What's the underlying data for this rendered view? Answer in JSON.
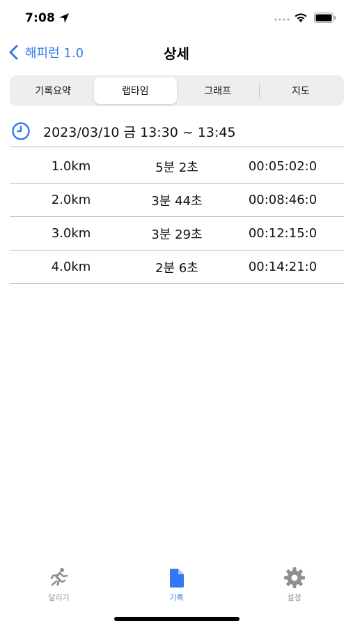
{
  "status_bar": {
    "time": "7:08",
    "icons": [
      "location-arrow-icon",
      "signal-dots-icon",
      "wifi-icon",
      "battery-icon"
    ]
  },
  "nav": {
    "back_label": "해피런 1.0",
    "title": "상세"
  },
  "segments": [
    {
      "label": "기록요약",
      "active": false
    },
    {
      "label": "랩타임",
      "active": true
    },
    {
      "label": "그래프",
      "active": false
    },
    {
      "label": "지도",
      "active": false
    }
  ],
  "session": {
    "datetime": "2023/03/10 금 13:30 ~ 13:45"
  },
  "laps": [
    {
      "distance": "1.0km",
      "split": "5분 2초",
      "elapsed": "00:05:02:0"
    },
    {
      "distance": "2.0km",
      "split": "3분 44초",
      "elapsed": "00:08:46:0"
    },
    {
      "distance": "3.0km",
      "split": "3분 29초",
      "elapsed": "00:12:15:0"
    },
    {
      "distance": "4.0km",
      "split": "2분 6초",
      "elapsed": "00:14:21:0"
    }
  ],
  "tabs": [
    {
      "label": "달리기",
      "icon": "running-person-icon",
      "active": false
    },
    {
      "label": "기록",
      "icon": "document-icon",
      "active": true
    },
    {
      "label": "설정",
      "icon": "gear-icon",
      "active": false
    }
  ],
  "colors": {
    "accent": "#3478f6",
    "inactive": "#8e8e93",
    "divider": "#b9b9bd",
    "segment_bg": "#eeeef0"
  }
}
